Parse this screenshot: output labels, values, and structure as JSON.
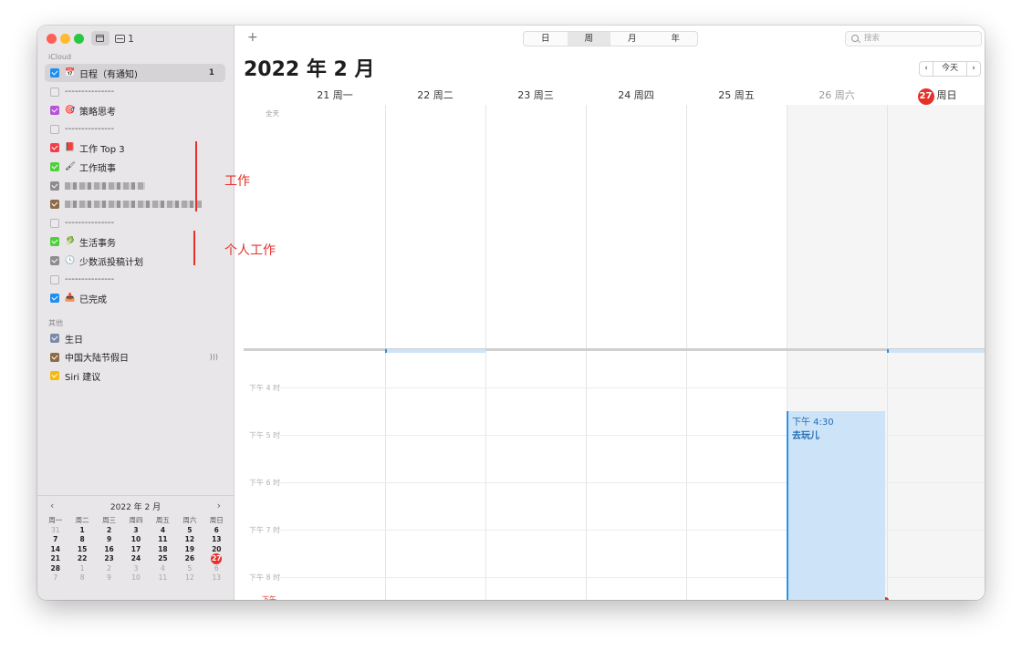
{
  "toolbar": {
    "inbox_count": "1",
    "add": "+",
    "views": [
      "日",
      "周",
      "月",
      "年"
    ],
    "active_view": "周",
    "search_placeholder": "搜索"
  },
  "sidebar": {
    "group_icloud": "iCloud",
    "items": [
      {
        "label": "日程（有通知)",
        "icon": "calendar-emoji",
        "emoji": "📅",
        "color": "#1e8ef0",
        "checked": true,
        "count": "1"
      },
      {
        "label": "---------------",
        "color": "",
        "checked": false
      },
      {
        "label": "策略思考",
        "icon": "dart-emoji",
        "emoji": "🎯",
        "color": "#b455d8",
        "checked": true
      },
      {
        "label": "---------------",
        "color": "",
        "checked": false
      },
      {
        "label": "工作 Top 3",
        "icon": "book-emoji",
        "emoji": "📕",
        "color": "#ee3f4c",
        "checked": true
      },
      {
        "label": "工作琐事",
        "icon": "brush-emoji",
        "emoji": "🖌",
        "color": "#4fcf3c",
        "checked": true
      },
      {
        "label": "",
        "color": "#8e8c8e",
        "checked": true,
        "blurred": true
      },
      {
        "label": "",
        "color": "#8b6b48",
        "checked": true,
        "blurred": true
      },
      {
        "label": "---------------",
        "color": "",
        "checked": false
      },
      {
        "label": "生活事务",
        "icon": "leaf-emoji",
        "emoji": "🥬",
        "color": "#4fcf3c",
        "checked": true
      },
      {
        "label": "少数派投稿计划",
        "icon": "clock-emoji",
        "emoji": "🕓",
        "color": "#8e8c8e",
        "checked": true
      },
      {
        "label": "---------------",
        "color": "",
        "checked": false
      },
      {
        "label": "已完成",
        "icon": "inbox-emoji",
        "emoji": "📥",
        "color": "#1e8ef0",
        "checked": true
      }
    ],
    "group_other": "其他",
    "other_items": [
      {
        "label": "生日",
        "color": "#7a89a6"
      },
      {
        "label": "中国大陆节假日",
        "color": "#8b6b48",
        "sound": ")))"
      },
      {
        "label": "Siri 建议",
        "color": "#f5b90d"
      }
    ]
  },
  "mini_calendar": {
    "title": "2022 年 2 月",
    "prev": "‹",
    "next": "›",
    "dow": [
      "周一",
      "周二",
      "周三",
      "周四",
      "周五",
      "周六",
      "周日"
    ],
    "weeks": [
      [
        "31",
        "1",
        "2",
        "3",
        "4",
        "5",
        "6"
      ],
      [
        "7",
        "8",
        "9",
        "10",
        "11",
        "12",
        "13"
      ],
      [
        "14",
        "15",
        "16",
        "17",
        "18",
        "19",
        "20"
      ],
      [
        "21",
        "22",
        "23",
        "24",
        "25",
        "26",
        "27"
      ],
      [
        "28",
        "1",
        "2",
        "3",
        "4",
        "5",
        "6"
      ],
      [
        "7",
        "8",
        "9",
        "10",
        "11",
        "12",
        "13"
      ]
    ],
    "today": "27"
  },
  "main": {
    "title": "2022 年 2 月",
    "nav": {
      "prev": "‹",
      "today": "今天",
      "next": "›"
    },
    "days": [
      {
        "label": "21 周一"
      },
      {
        "label": "22 周二"
      },
      {
        "label": "23 周三"
      },
      {
        "label": "24 周四"
      },
      {
        "label": "25 周五"
      },
      {
        "label": "26 周六"
      },
      {
        "label": "周日",
        "badge": "27"
      }
    ],
    "allday_label": "全天",
    "time_labels": [
      "下午 4 时",
      "下午 5 时",
      "下午 6 时",
      "下午 7 时",
      "下午 8 时"
    ],
    "now_label": "下午",
    "event": {
      "time": "下午 4:30",
      "name": "去玩儿",
      "color": "#cde3f8"
    }
  },
  "annotations": {
    "work": "工作",
    "personal": "个人工作",
    "color": "#e4322b"
  }
}
